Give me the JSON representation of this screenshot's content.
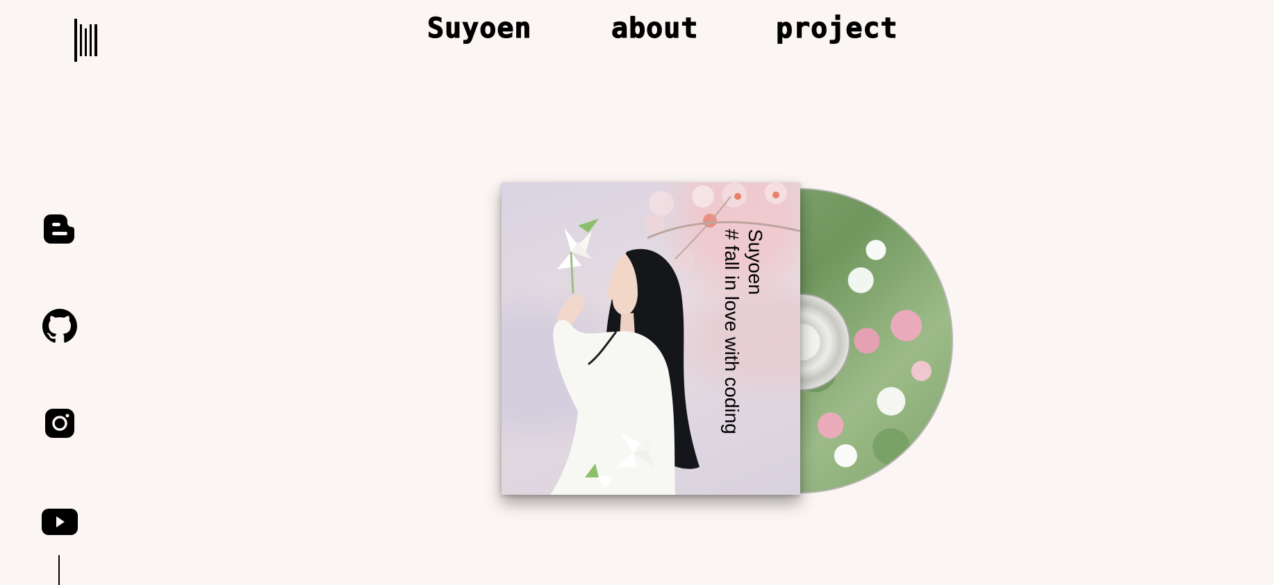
{
  "nav": {
    "items": [
      {
        "label": "Suyoen"
      },
      {
        "label": "about"
      },
      {
        "label": "project"
      }
    ]
  },
  "logo": {
    "icon": "barcode-logo-icon"
  },
  "social": [
    {
      "icon": "blogger-icon"
    },
    {
      "icon": "github-icon"
    },
    {
      "icon": "instagram-icon"
    },
    {
      "icon": "youtube-icon"
    }
  ],
  "album": {
    "title": "Suyoen",
    "subtitle": "# fall in love with coding"
  },
  "colors": {
    "background": "#fbf5f3",
    "text": "#000000"
  }
}
